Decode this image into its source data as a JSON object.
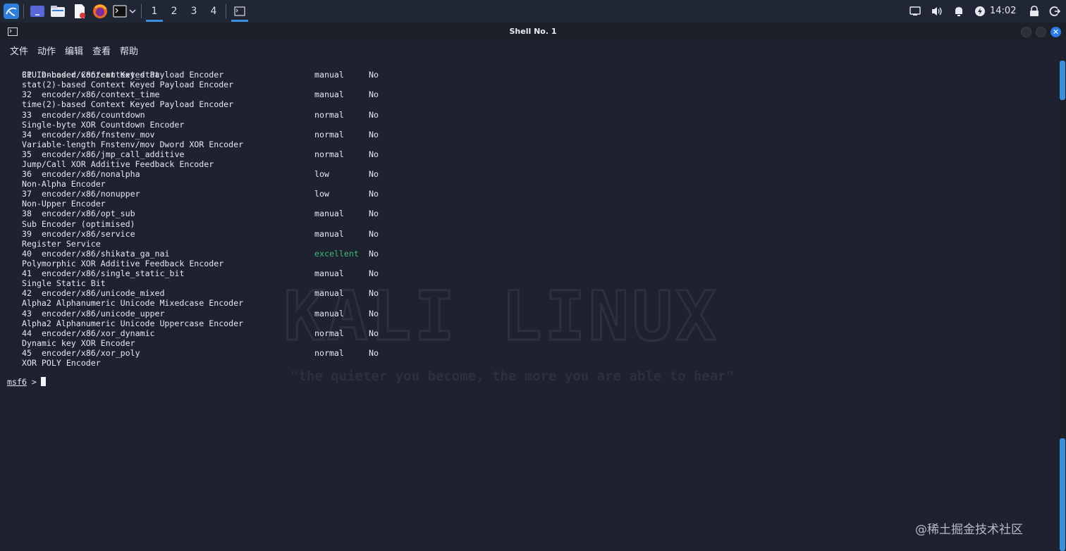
{
  "taskbar": {
    "workspaces": [
      "1",
      "2",
      "3",
      "4"
    ],
    "active_workspace": "1",
    "time": "14:02",
    "icons": [
      "kali-menu-icon",
      "show-desktop-icon",
      "file-manager-icon",
      "text-editor-icon",
      "firefox-icon",
      "terminal-icon",
      "dropdown-icon",
      "terminal-window-icon",
      "notification-icon",
      "volume-icon",
      "bell-icon",
      "power-icon",
      "lock-icon",
      "logout-icon"
    ]
  },
  "window": {
    "title": "Shell No. 1"
  },
  "menu": [
    "文件",
    "动作",
    "编辑",
    "查看",
    "帮助"
  ],
  "terminal": {
    "top_desc": "CPUID-based Context Keyed Payload Encoder",
    "entries": [
      {
        "idx": "31",
        "name": "encoder/x86/context_stat",
        "rank": "manual",
        "check": "No",
        "desc": "stat(2)-based Context Keyed Payload Encoder"
      },
      {
        "idx": "32",
        "name": "encoder/x86/context_time",
        "rank": "manual",
        "check": "No",
        "desc": "time(2)-based Context Keyed Payload Encoder"
      },
      {
        "idx": "33",
        "name": "encoder/x86/countdown",
        "rank": "normal",
        "check": "No",
        "desc": "Single-byte XOR Countdown Encoder"
      },
      {
        "idx": "34",
        "name": "encoder/x86/fnstenv_mov",
        "rank": "normal",
        "check": "No",
        "desc": "Variable-length Fnstenv/mov Dword XOR Encoder"
      },
      {
        "idx": "35",
        "name": "encoder/x86/jmp_call_additive",
        "rank": "normal",
        "check": "No",
        "desc": "Jump/Call XOR Additive Feedback Encoder"
      },
      {
        "idx": "36",
        "name": "encoder/x86/nonalpha",
        "rank": "low",
        "check": "No",
        "desc": "Non-Alpha Encoder"
      },
      {
        "idx": "37",
        "name": "encoder/x86/nonupper",
        "rank": "low",
        "check": "No",
        "desc": "Non-Upper Encoder"
      },
      {
        "idx": "38",
        "name": "encoder/x86/opt_sub",
        "rank": "manual",
        "check": "No",
        "desc": "Sub Encoder (optimised)"
      },
      {
        "idx": "39",
        "name": "encoder/x86/service",
        "rank": "manual",
        "check": "No",
        "desc": "Register Service"
      },
      {
        "idx": "40",
        "name": "encoder/x86/shikata_ga_nai",
        "rank": "excellent",
        "check": "No",
        "desc": "Polymorphic XOR Additive Feedback Encoder"
      },
      {
        "idx": "41",
        "name": "encoder/x86/single_static_bit",
        "rank": "manual",
        "check": "No",
        "desc": "Single Static Bit"
      },
      {
        "idx": "42",
        "name": "encoder/x86/unicode_mixed",
        "rank": "manual",
        "check": "No",
        "desc": "Alpha2 Alphanumeric Unicode Mixedcase Encoder"
      },
      {
        "idx": "43",
        "name": "encoder/x86/unicode_upper",
        "rank": "manual",
        "check": "No",
        "desc": "Alpha2 Alphanumeric Unicode Uppercase Encoder"
      },
      {
        "idx": "44",
        "name": "encoder/x86/xor_dynamic",
        "rank": "normal",
        "check": "No",
        "desc": "Dynamic key XOR Encoder"
      },
      {
        "idx": "45",
        "name": "encoder/x86/xor_poly",
        "rank": "normal",
        "check": "No",
        "desc": "XOR POLY Encoder"
      }
    ],
    "prompt": "msf6",
    "prompt_symbol": ">",
    "watermark_title": "KALI LINUX",
    "watermark_quote": "\"the quieter you become, the more you are able to hear\""
  },
  "colors": {
    "excellent": "#3fb97e",
    "accent": "#3a8fdc",
    "background": "#1e2230"
  },
  "credit": "@稀土掘金技术社区"
}
